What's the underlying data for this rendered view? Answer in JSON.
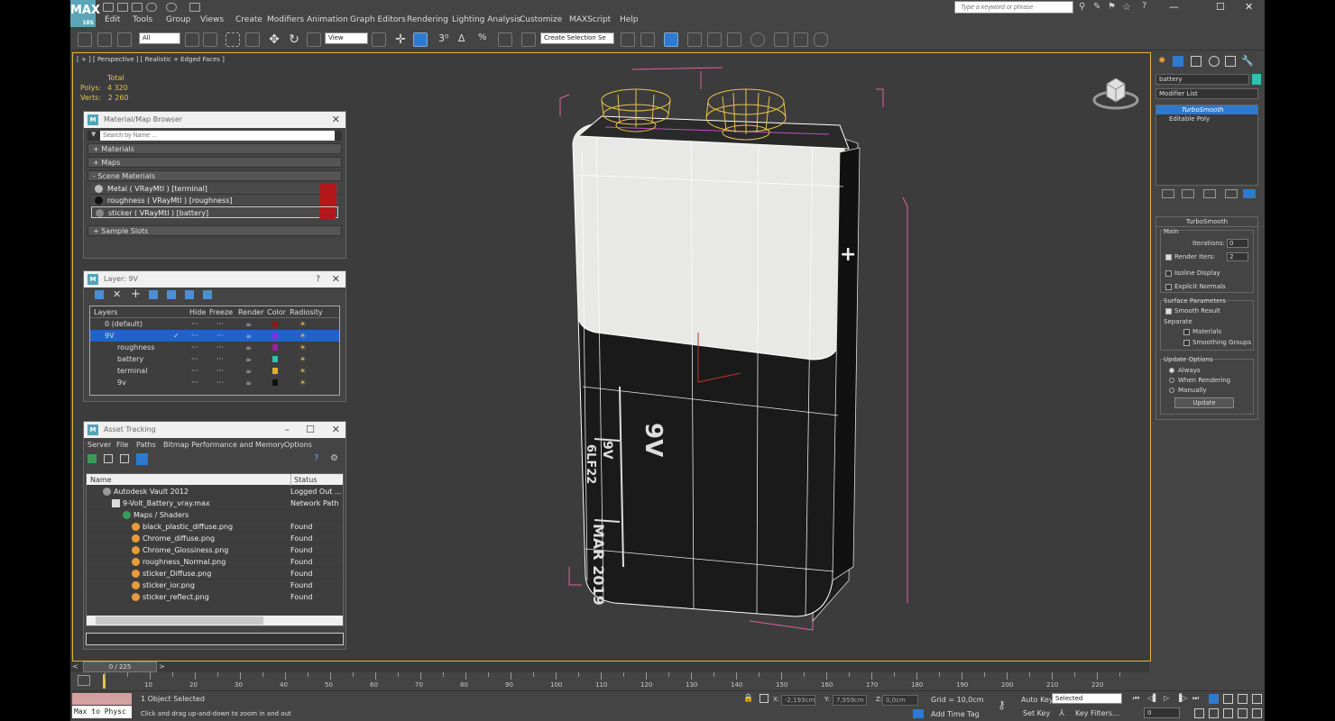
{
  "app": {
    "logo_text": "MAX",
    "logo_sub": "18S"
  },
  "menu": {
    "items": [
      "Edit",
      "Tools",
      "Group",
      "Views",
      "Create",
      "Modifiers",
      "Animation",
      "Graph Editors",
      "Rendering",
      "Lighting Analysis",
      "Customize",
      "MAXScript",
      "Help"
    ]
  },
  "search": {
    "placeholder": "Type a keyword or phrase"
  },
  "window_controls": {
    "minimize": "—",
    "maximize": "☐",
    "close": "✕"
  },
  "toolbar": {
    "selection_filter": "All",
    "ref_coord": "View",
    "named_selection": "Create Selection Se"
  },
  "viewport": {
    "label": "[ + ] [ Perspective ] [ Realistic + Edged Faces ]",
    "stats_header": "Total",
    "polys_label": "Polys:",
    "polys_value": "4 320",
    "verts_label": "Verts:",
    "verts_value": "2 260",
    "battery_text": [
      "9V",
      "9V",
      "6LF22",
      "MAR 2019"
    ]
  },
  "material_browser": {
    "title": "Material/Map Browser",
    "search_placeholder": "Search by Name ...",
    "rollouts": [
      "+ Materials",
      "+ Maps",
      "- Scene Materials",
      "+ Sample Slots"
    ],
    "materials": [
      {
        "label": "Metal  ( VRayMtl ) [terminal]",
        "ball": "#bbbbbb"
      },
      {
        "label": "roughness  ( VRayMtl ) [roughness]",
        "ball": "#111111"
      },
      {
        "label": "sticker  ( VRayMtl ) [battery]",
        "ball": "#888888"
      }
    ]
  },
  "layer_panel": {
    "title": "Layer: 9V",
    "columns": [
      "Layers",
      "Hide",
      "Freeze",
      "Render",
      "Color",
      "Radiosity"
    ],
    "rows": [
      {
        "name": "0 (default)",
        "color": "#8b1a1a"
      },
      {
        "name": "9V",
        "color": "#8a2be2"
      },
      {
        "name": "roughness",
        "color": "#a020a0"
      },
      {
        "name": "battery",
        "color": "#30c0b0"
      },
      {
        "name": "terminal",
        "color": "#e0b020"
      },
      {
        "name": "9v",
        "color": "#111111"
      }
    ]
  },
  "asset_tracking": {
    "title": "Asset Tracking",
    "menu": [
      "Server",
      "File",
      "Paths",
      "Bitmap Performance and Memory",
      "Options"
    ],
    "columns": [
      "Name",
      "Status"
    ],
    "rows": [
      {
        "name": "Autodesk Vault 2012",
        "status": "Logged Out ..."
      },
      {
        "name": "9-Volt_Battery_vray.max",
        "status": "Network Path"
      },
      {
        "name": "Maps / Shaders",
        "status": ""
      },
      {
        "name": "black_plastic_diffuse.png",
        "status": "Found"
      },
      {
        "name": "Chrome_diffuse.png",
        "status": "Found"
      },
      {
        "name": "Chrome_Glossiness.png",
        "status": "Found"
      },
      {
        "name": "roughness_Normal.png",
        "status": "Found"
      },
      {
        "name": "sticker_Diffuse.png",
        "status": "Found"
      },
      {
        "name": "sticker_ior.png",
        "status": "Found"
      },
      {
        "name": "sticker_reflect.png",
        "status": "Found"
      }
    ]
  },
  "command_panel": {
    "object_name": "battery",
    "modifier_list": "Modifier List",
    "stack": [
      "TurboSmooth",
      "Editable Poly"
    ],
    "rollout_title": "TurboSmooth",
    "main_label": "Main",
    "iterations_label": "Iterations:",
    "iterations_value": "0",
    "render_iters_label": "Render Iters:",
    "render_iters_value": "2",
    "isoline": "Isoline Display",
    "explicit_normals": "Explicit Normals",
    "surface_params": "Surface Parameters",
    "smooth_result": "Smooth Result",
    "separate": "Separate",
    "materials": "Materials",
    "smoothing_groups": "Smoothing Groups",
    "update_options": "Update Options",
    "always": "Always",
    "when_rendering": "When Rendering",
    "manually": "Manually",
    "update_button": "Update"
  },
  "timeline": {
    "frame_counter": "0 / 225",
    "ticks": [
      "10",
      "20",
      "30",
      "40",
      "50",
      "60",
      "70",
      "80",
      "90",
      "100",
      "110",
      "120",
      "130",
      "140",
      "150",
      "160",
      "170",
      "180",
      "190",
      "200",
      "210",
      "220"
    ]
  },
  "status": {
    "script_label": "Max to Physc",
    "selected": "1 Object Selected",
    "prompt": "Click and drag up-and-down to zoom in and out",
    "x_label": "X:",
    "x_value": "-2,193cm",
    "y_label": "Y:",
    "y_value": "7,959cm",
    "z_label": "Z:",
    "z_value": "0,0cm",
    "grid": "Grid = 10,0cm",
    "add_time_tag": "Add Time Tag",
    "auto_key": "Auto Key",
    "auto_key_value": "Selected",
    "set_key": "Set Key",
    "key_filters": "Key Filters...",
    "frame_value": "0"
  }
}
